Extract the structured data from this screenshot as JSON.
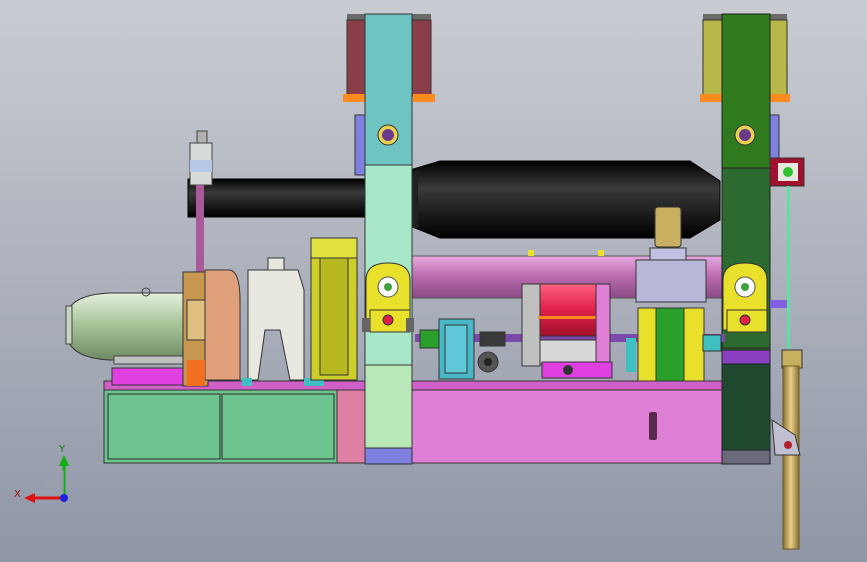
{
  "viewport": {
    "background_top": "#c9ccd2",
    "background_bottom": "#8f96a6"
  },
  "triad": {
    "x_label": "X",
    "y_label": "Y",
    "x_color": "#e01010",
    "y_color": "#10b010",
    "z_color": "#2020e0"
  },
  "palette": {
    "base_frame": "#e07fd6",
    "base_cabinet": "#6ec48f",
    "left_column": "#6ec4c0",
    "right_column": "#2f7a1f",
    "upper_roll": "#111111",
    "lower_roll": "#c87ac0",
    "motor": "#b5cfa8",
    "gearbox": "#cfcf2a",
    "coupling": "#e0a07a",
    "bearing_block": "#e8e02a",
    "drum": "#e0204a",
    "pump": "#48b8c8",
    "cylinder": "#c8b060",
    "hydraulic_pipe": "#a85a9a",
    "guide_rod": "#60e0a0",
    "column_cap_left": "#8a3f48",
    "column_cap_right": "#b8b848",
    "plate": "#e8e8e0",
    "magenta": "#e040e0",
    "purple": "#8060e0"
  }
}
